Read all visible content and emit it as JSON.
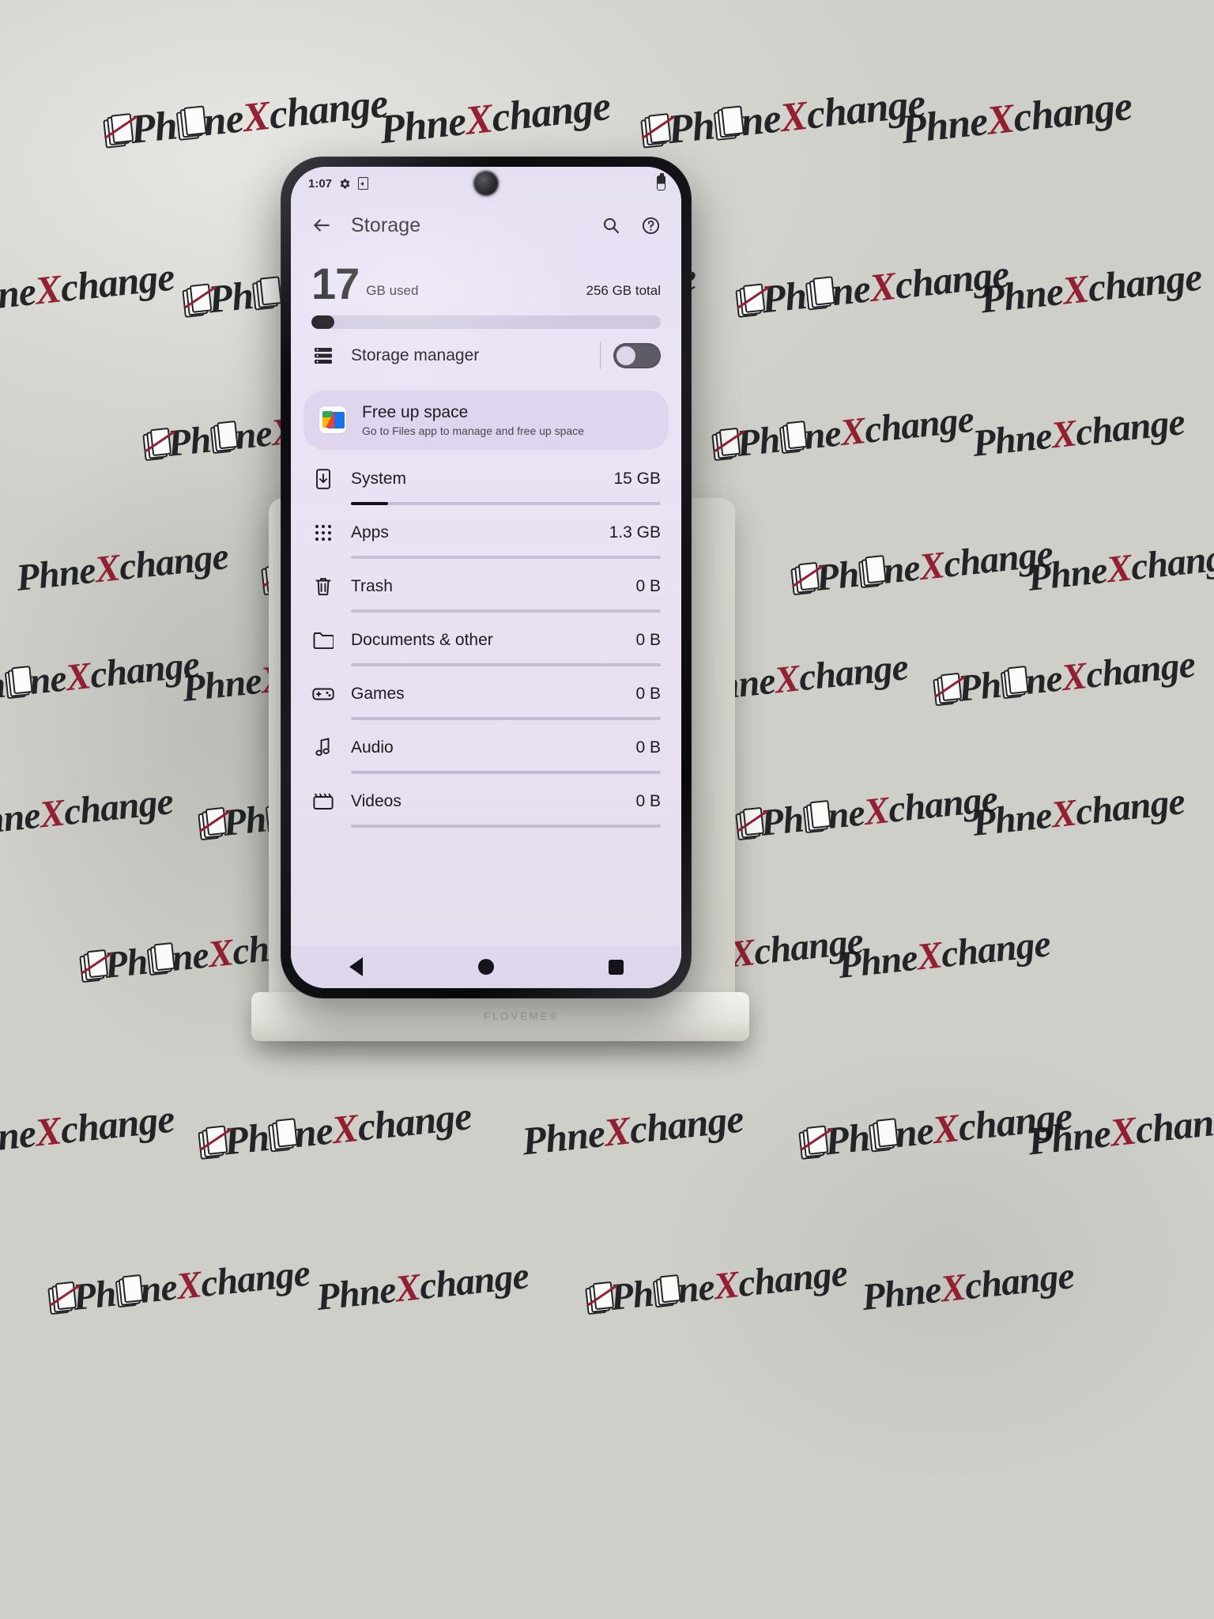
{
  "backdrop": {
    "watermark_text": "PhoneXchange",
    "watermark_part1": "Ph",
    "watermark_part2": "ne",
    "watermark_x": "X",
    "watermark_part3": "change"
  },
  "stand": {
    "brand": "FLOVEME®"
  },
  "phone": {
    "statusbar": {
      "time": "1:07",
      "icons": [
        "gear-icon",
        "sim-card-icon"
      ],
      "battery_icon": "battery-icon"
    },
    "appbar": {
      "back_icon": "arrow-back-icon",
      "title": "Storage",
      "search_icon": "search-icon",
      "help_icon": "help-circle-icon"
    },
    "usage": {
      "used_number": "17",
      "used_unit": "GB used",
      "total": "256 GB total",
      "used_percent": 6.6
    },
    "storage_manager": {
      "icon": "list-rows-icon",
      "label": "Storage manager",
      "toggle_on": false
    },
    "free_up_space": {
      "icon": "files-app-icon",
      "title": "Free up space",
      "subtitle": "Go to Files app to manage and free up space"
    },
    "categories": [
      {
        "icon": "system-update-icon",
        "label": "System",
        "value": "15 GB",
        "bar_percent": 12
      },
      {
        "icon": "apps-grid-icon",
        "label": "Apps",
        "value": "1.3 GB",
        "bar_percent": 0
      },
      {
        "icon": "trash-icon",
        "label": "Trash",
        "value": "0 B",
        "bar_percent": 0
      },
      {
        "icon": "folder-icon",
        "label": "Documents & other",
        "value": "0 B",
        "bar_percent": 0
      },
      {
        "icon": "gamepad-icon",
        "label": "Games",
        "value": "0 B",
        "bar_percent": 0
      },
      {
        "icon": "music-note-icon",
        "label": "Audio",
        "value": "0 B",
        "bar_percent": 0
      },
      {
        "icon": "video-icon",
        "label": "Videos",
        "value": "0 B",
        "bar_percent": 0
      }
    ],
    "navbar": {
      "back": "nav-back-icon",
      "home": "nav-home-icon",
      "recents": "nav-recents-icon"
    }
  },
  "colors": {
    "screen_bg": "#efe6f7",
    "accent_dark": "#1d1b20",
    "card_bg": "#e1d6f0",
    "track": "#cfc8e0",
    "watermark_red": "#8e1126"
  }
}
